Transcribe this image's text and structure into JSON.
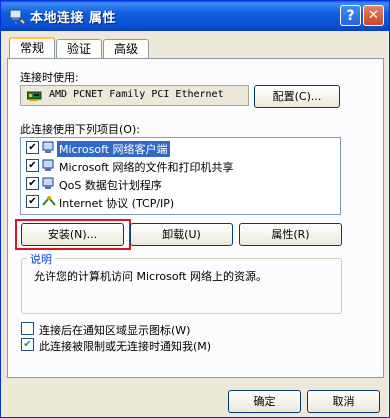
{
  "window": {
    "title": "本地连接 属性"
  },
  "titlebar": {
    "help": "?",
    "close": "✕"
  },
  "tabs": [
    {
      "label": "常规"
    },
    {
      "label": "验证"
    },
    {
      "label": "高级"
    }
  ],
  "general": {
    "connect_using_label": "连接时使用:",
    "adapter_name": "AMD PCNET Family PCI Ethernet",
    "configure_button": "配置(C)...",
    "components_label": "此连接使用下列项目(O):",
    "components": [
      {
        "label": "Microsoft 网络客户端",
        "checked": true,
        "selected": true,
        "icon": "network-client-icon"
      },
      {
        "label": "Microsoft 网络的文件和打印机共享",
        "checked": true,
        "selected": false,
        "icon": "file-printer-sharing-icon"
      },
      {
        "label": "QoS 数据包计划程序",
        "checked": true,
        "selected": false,
        "icon": "qos-scheduler-icon"
      },
      {
        "label": "Internet 协议 (TCP/IP)",
        "checked": true,
        "selected": false,
        "icon": "tcpip-protocol-icon"
      }
    ],
    "install_button": "安装(N)...",
    "uninstall_button": "卸载(U)",
    "properties_button": "属性(R)",
    "description_legend": "说明",
    "description_text": "允许您的计算机访问 Microsoft 网络上的资源。",
    "show_icon_option": {
      "label": "连接后在通知区域显示图标(W)",
      "checked": false
    },
    "notify_option": {
      "label": "此连接被限制或无连接时通知我(M)",
      "checked": true
    }
  },
  "footer": {
    "ok_button": "确定",
    "cancel_button": "取消"
  },
  "colors": {
    "titlebar": "#0a5ee8",
    "selection": "#316ac5",
    "highlight_box": "#d8161d",
    "dialog_bg": "#ece9d8"
  }
}
